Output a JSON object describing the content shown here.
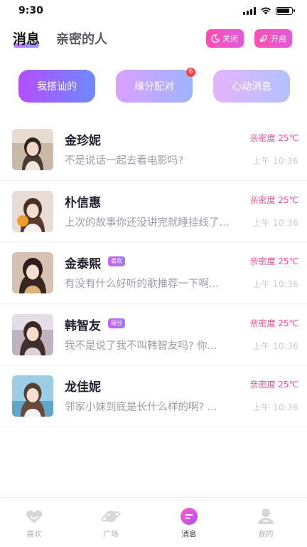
{
  "status_bar": {
    "time": "9:30"
  },
  "header": {
    "tabs": [
      {
        "label": "消息"
      },
      {
        "label": "亲密的人"
      }
    ],
    "btn_off": {
      "label": "关闭",
      "icon": "moon-icon"
    },
    "btn_on": {
      "label": "开启",
      "icon": "leaf-icon"
    }
  },
  "shortcuts": [
    {
      "label": "我搭讪的"
    },
    {
      "label": "缘分配对",
      "badge": "6"
    },
    {
      "label": "心动消息"
    }
  ],
  "conversations": [
    {
      "name": "金珍妮",
      "tag": "",
      "message": "不是说话一起去看电影吗?",
      "intimacy": "亲密度 25℃",
      "time": "上午 10:36"
    },
    {
      "name": "朴信惠",
      "tag": "",
      "message": "上次的故事你还没讲完就睡挂线了...",
      "intimacy": "亲密度 25℃",
      "time": "上午 10:36"
    },
    {
      "name": "金泰熙",
      "tag": "喜欢",
      "message": "有没有什么好听的歌推荐一下啊...",
      "intimacy": "亲密度 25℃",
      "time": "上午 10:36"
    },
    {
      "name": "韩智友",
      "tag": "缘分",
      "message": "我不是说了我不叫韩智友吗? 你...",
      "intimacy": "亲密度 25℃",
      "time": "上午 10:36"
    },
    {
      "name": "龙佳妮",
      "tag": "",
      "message": "邻家小妹到底是长什么样的啊? ...",
      "intimacy": "亲密度 25℃",
      "time": "上午 10:36"
    }
  ],
  "tabbar": [
    {
      "label": "喜欢",
      "icon": "heart-icon",
      "active": false
    },
    {
      "label": "广场",
      "icon": "planet-icon",
      "active": false
    },
    {
      "label": "消息",
      "icon": "message-icon",
      "active": true
    },
    {
      "label": "我的",
      "icon": "user-icon",
      "active": false
    }
  ],
  "colors": {
    "accent_pink": "#ef4f9e",
    "gradient_start": "#b44dff",
    "gradient_end": "#6b8bff"
  }
}
